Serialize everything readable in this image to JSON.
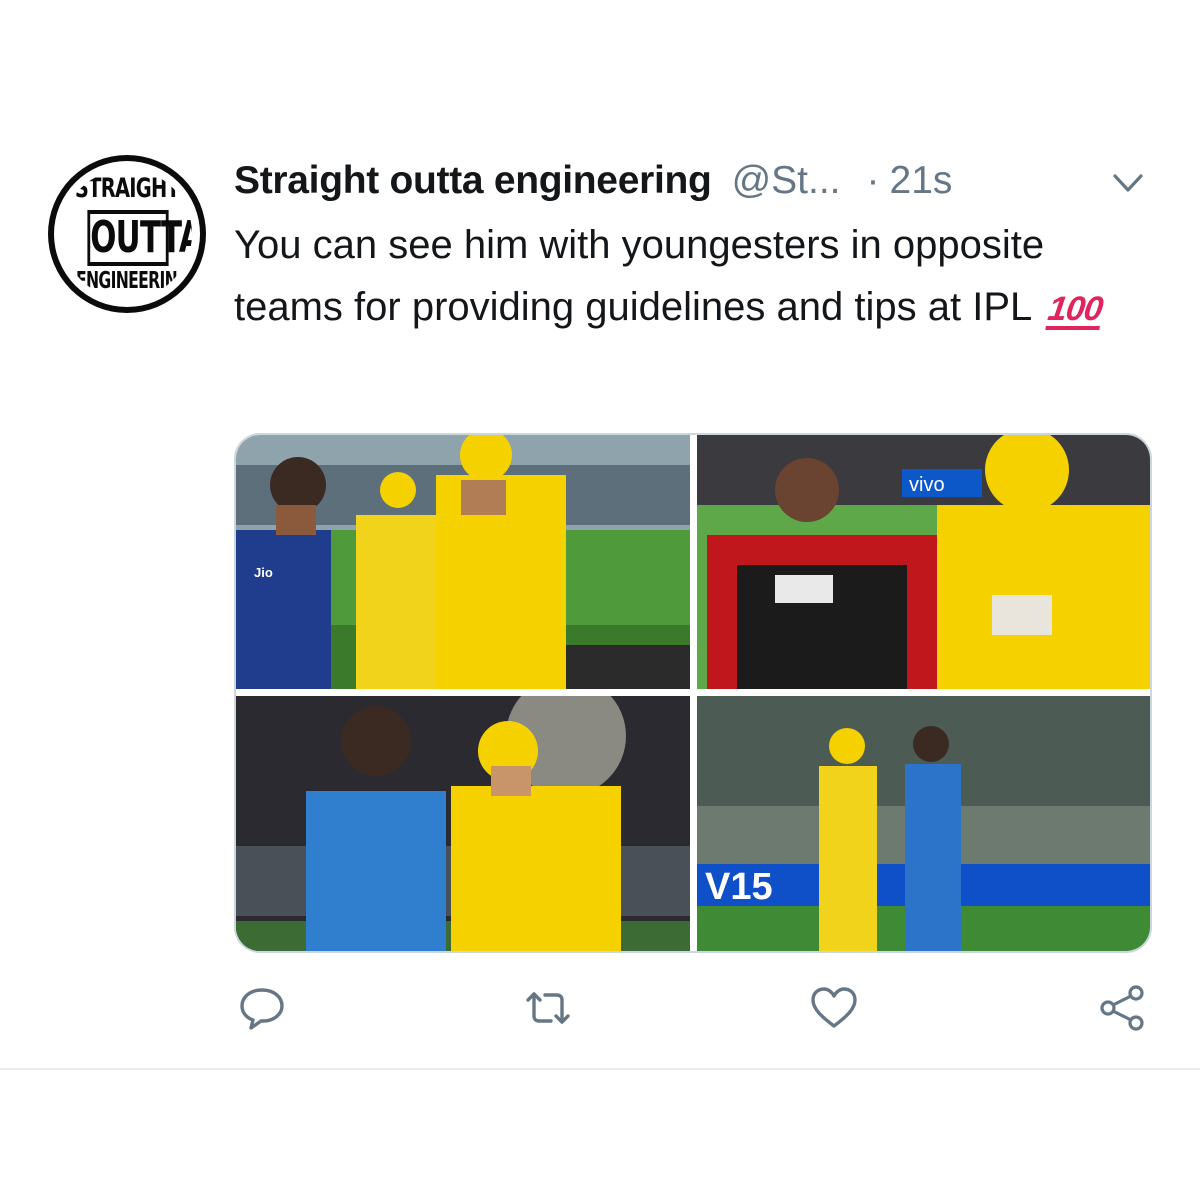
{
  "author": {
    "avatar_logo": [
      "STRAIGHT",
      "OUTTA",
      "ENGINEERING"
    ],
    "display_name": "Straight outta engineering",
    "handle": "@St...",
    "separator": "·",
    "timestamp": "21s"
  },
  "tweet": {
    "text": "You can see him with youngesters in opposite teams for providing guidelines and tips at IPL",
    "emoji": "💯",
    "emoji_glyph_text": "100"
  },
  "media": {
    "photos": [
      {
        "name": "photo-1",
        "overlay_text": "Jio"
      },
      {
        "name": "photo-2",
        "overlay_text": "vivo"
      },
      {
        "name": "photo-3",
        "overlay_text": ""
      },
      {
        "name": "photo-4",
        "overlay_text": "V15"
      }
    ]
  },
  "actions": {
    "icons": [
      "reply-icon",
      "retweet-icon",
      "like-icon",
      "share-icon"
    ]
  },
  "colors": {
    "text": "#14171a",
    "secondary": "#657786",
    "border": "#ccd6dd",
    "emoji_red": "#e0245e",
    "csk_yellow": "#f5d100",
    "divider": "#e6ecf0"
  }
}
